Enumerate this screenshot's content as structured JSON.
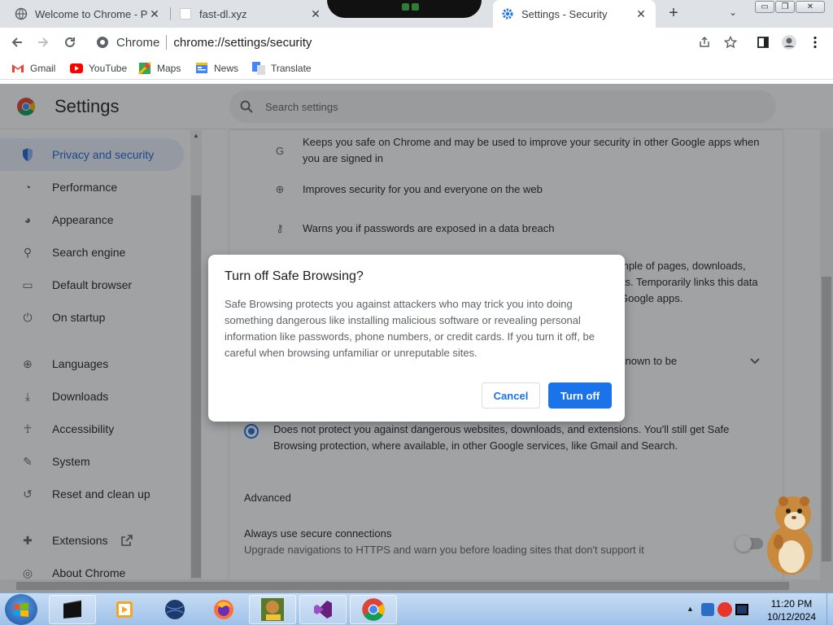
{
  "tabs": [
    {
      "title": "Welcome to Chrome - Pi",
      "close": "✕"
    },
    {
      "title": "fast-dl.xyz",
      "close": "✕"
    },
    {
      "title": "Settings - Security",
      "close": "✕"
    }
  ],
  "new_tab": "+",
  "tab_search": "⌄",
  "window_controls": {
    "minimize": "▭",
    "restore": "❐",
    "close": "✕"
  },
  "toolbar": {
    "chip": "Chrome",
    "url": "chrome://settings/security"
  },
  "bookmarks": [
    {
      "label": "Gmail",
      "icon": "gmail-icon",
      "color": "#ea4335"
    },
    {
      "label": "YouTube",
      "icon": "youtube-icon",
      "color": "#ff0000"
    },
    {
      "label": "Maps",
      "icon": "maps-icon",
      "color": "#34a853"
    },
    {
      "label": "News",
      "icon": "news-icon",
      "color": "#4285f4"
    },
    {
      "label": "Translate",
      "icon": "translate-icon",
      "color": "#4285f4"
    }
  ],
  "settings": {
    "title": "Settings",
    "search_placeholder": "Search settings",
    "nav": [
      {
        "label": "Privacy and security",
        "icon": "shield-icon",
        "glyph": "⛊"
      },
      {
        "label": "Performance",
        "icon": "gauge-icon",
        "glyph": "◔"
      },
      {
        "label": "Appearance",
        "icon": "palette-icon",
        "glyph": "◕"
      },
      {
        "label": "Search engine",
        "icon": "search-icon",
        "glyph": "⚲"
      },
      {
        "label": "Default browser",
        "icon": "browser-icon",
        "glyph": "▭"
      },
      {
        "label": "On startup",
        "icon": "power-icon",
        "glyph": "⏻"
      },
      {
        "label": "Languages",
        "icon": "globe-icon",
        "glyph": "⊕"
      },
      {
        "label": "Downloads",
        "icon": "download-icon",
        "glyph": "⤓"
      },
      {
        "label": "Accessibility",
        "icon": "accessibility-icon",
        "glyph": "☥"
      },
      {
        "label": "System",
        "icon": "wrench-icon",
        "glyph": "✎"
      },
      {
        "label": "Reset and clean up",
        "icon": "history-icon",
        "glyph": "↺"
      },
      {
        "label": "Extensions",
        "icon": "puzzle-icon",
        "glyph": "✚"
      },
      {
        "label": "About Chrome",
        "icon": "chrome-icon",
        "glyph": "◎"
      }
    ],
    "rows": [
      {
        "text": "Keeps you safe on Chrome and may be used to improve your security in other Google apps when you are signed in",
        "icon": "google-icon",
        "glyph": "G"
      },
      {
        "text": "Improves security for you and everyone on the web",
        "icon": "globe-icon",
        "glyph": "⊕"
      },
      {
        "text": "Warns you if passwords are exposed in a data breach",
        "icon": "key-icon",
        "glyph": "⚷"
      }
    ],
    "partial_right": [
      "mple of pages, downloads,",
      "its. Temporarily links this data",
      "Google apps."
    ],
    "partial_known": "known to be",
    "no_protection_text": "Does not protect you against dangerous websites, downloads, and extensions. You'll still get Safe Browsing protection, where available, in other Google services, like Gmail and Search.",
    "advanced_label": "Advanced",
    "secure_title": "Always use secure connections",
    "secure_desc": "Upgrade navigations to HTTPS and warn you before loading sites that don't support it"
  },
  "dialog": {
    "title": "Turn off Safe Browsing?",
    "body": "Safe Browsing protects you against attackers who may trick you into doing something dangerous like installing malicious software or revealing personal information like passwords, phone numbers, or credit cards. If you turn it off, be careful when browsing unfamiliar or unreputable sites.",
    "cancel": "Cancel",
    "confirm": "Turn off"
  },
  "taskbar": {
    "apps": [
      "terminal-icon",
      "media-player-icon",
      "globe-app-icon",
      "firefox-icon",
      "game-box-icon",
      "visual-studio-icon",
      "chrome-icon"
    ],
    "time": "11:20 PM",
    "date": "10/12/2024"
  },
  "colors": {
    "accent": "#1a73e8",
    "selected_nav_bg": "#e8f0fe",
    "taskbar": "#b5d0ee"
  }
}
